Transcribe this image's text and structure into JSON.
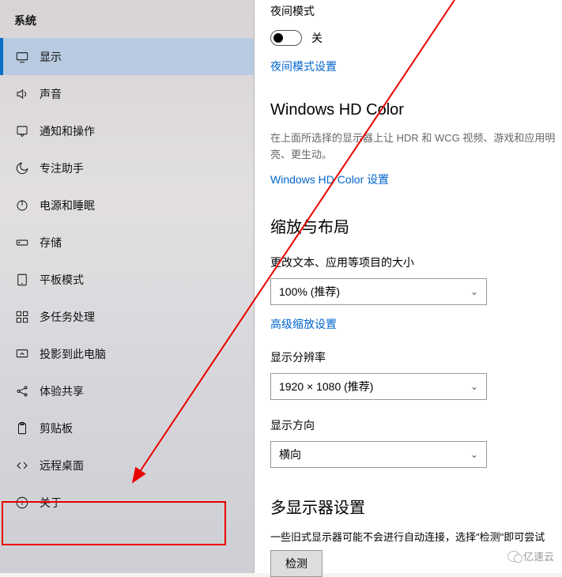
{
  "sidebar": {
    "header": "系统",
    "items": [
      {
        "label": "显示",
        "icon": "display-icon"
      },
      {
        "label": "声音",
        "icon": "sound-icon"
      },
      {
        "label": "通知和操作",
        "icon": "notification-icon"
      },
      {
        "label": "专注助手",
        "icon": "focus-icon"
      },
      {
        "label": "电源和睡眠",
        "icon": "power-icon"
      },
      {
        "label": "存储",
        "icon": "storage-icon"
      },
      {
        "label": "平板模式",
        "icon": "tablet-icon"
      },
      {
        "label": "多任务处理",
        "icon": "multitask-icon"
      },
      {
        "label": "投影到此电脑",
        "icon": "project-icon"
      },
      {
        "label": "体验共享",
        "icon": "share-icon"
      },
      {
        "label": "剪贴板",
        "icon": "clipboard-icon"
      },
      {
        "label": "远程桌面",
        "icon": "remote-icon"
      },
      {
        "label": "关于",
        "icon": "info-icon"
      }
    ]
  },
  "content": {
    "nightMode": {
      "title": "夜间模式",
      "toggleState": "关",
      "settingsLink": "夜间模式设置"
    },
    "hdColor": {
      "title": "Windows HD Color",
      "desc": "在上面所选择的显示器上让 HDR 和 WCG 视频、游戏和应用明亮、更生动。",
      "link": "Windows HD Color 设置"
    },
    "scale": {
      "title": "缩放与布局",
      "sizeLabel": "更改文本、应用等项目的大小",
      "sizeValue": "100% (推荐)",
      "advancedLink": "高级缩放设置",
      "resolutionLabel": "显示分辨率",
      "resolutionValue": "1920 × 1080 (推荐)",
      "orientationLabel": "显示方向",
      "orientationValue": "横向"
    },
    "multiDisplay": {
      "title": "多显示器设置",
      "desc": "一些旧式显示器可能不会进行自动连接，选择\"检测\"即可尝试",
      "button": "检测"
    }
  },
  "watermark": "亿速云"
}
